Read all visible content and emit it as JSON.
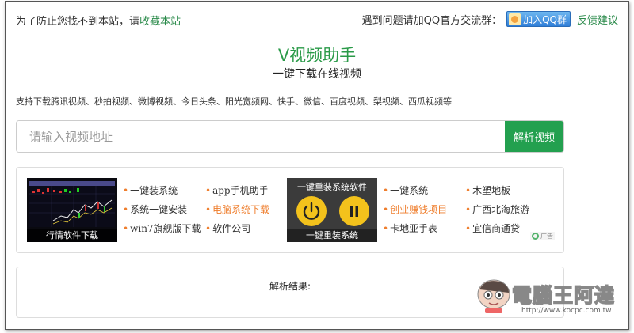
{
  "topbar": {
    "notice_prefix": "为了防止您找不到本站，请",
    "notice_link": "收藏本站",
    "qq_prompt": "遇到问题请加QQ官方交流群：",
    "qq_button": "加入QQ群",
    "feedback": "反馈建议"
  },
  "header": {
    "title": "V视频助手",
    "subtitle": "一键下载在线视频"
  },
  "support_text": "支持下载腾讯视频、秒拍视频、微博视频、今日头条、阳光宽频网、快手、微信、百度视频、梨视频、西瓜视频等",
  "search": {
    "placeholder": "请输入视频地址",
    "button": "解析视频"
  },
  "ads": {
    "banner_a_caption": "行情软件下载",
    "banner_b_top": "一键重装系统软件",
    "banner_b_caption": "一键重装系统",
    "col1": [
      "一键装系统",
      "系统一键安装",
      "win7旗舰版下载"
    ],
    "col2": [
      "app手机助手",
      "电脑系统下载",
      "软件公司"
    ],
    "col3": [
      "一键系统",
      "创业赚钱项目",
      "卡地亚手表"
    ],
    "col4": [
      "木塑地板",
      "广西北海旅游",
      "宜信商通贷"
    ],
    "highlighted": [
      "电脑系统下载",
      "创业赚钱项目"
    ],
    "badge": "广告",
    "accent_color": "#ef7e2d"
  },
  "result": {
    "label": "解析结果:"
  },
  "watermark": {
    "text": "電腦王阿達",
    "url": "http://www.kocpc.com.tw"
  },
  "colors": {
    "brand_green": "#23a04f",
    "link_green": "#2a8a4a"
  }
}
